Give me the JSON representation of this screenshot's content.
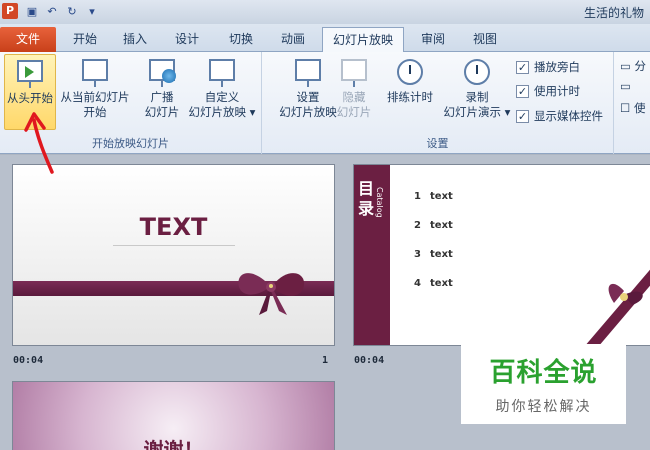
{
  "window": {
    "title": "生活的礼物",
    "app_icon": "P"
  },
  "quick_access": [
    "save-icon",
    "undo-icon",
    "redo-icon",
    "customize-icon"
  ],
  "tabs": [
    {
      "label": "文件",
      "file": true
    },
    {
      "label": "开始"
    },
    {
      "label": "插入"
    },
    {
      "label": "设计"
    },
    {
      "label": "切换"
    },
    {
      "label": "动画"
    },
    {
      "label": "幻灯片放映",
      "active": true
    },
    {
      "label": "审阅"
    },
    {
      "label": "视图"
    }
  ],
  "ribbon": {
    "start_group": {
      "label": "开始放映幻灯片",
      "from_beginning": "从头开始",
      "from_current_l1": "从当前幻灯片",
      "from_current_l2": "开始",
      "broadcast_l1": "广播",
      "broadcast_l2": "幻灯片",
      "custom_l1": "自定义",
      "custom_l2": "幻灯片放映 ▾"
    },
    "setup_group": {
      "label": "设置",
      "setup_l1": "设置",
      "setup_l2": "幻灯片放映",
      "hide_l1": "隐藏",
      "hide_l2": "幻灯片",
      "rehearse": "排练计时",
      "record_l1": "录制",
      "record_l2": "幻灯片演示 ▾",
      "checks": [
        {
          "label": "播放旁白",
          "checked": true
        },
        {
          "label": "使用计时",
          "checked": true
        },
        {
          "label": "显示媒体控件",
          "checked": true
        }
      ]
    },
    "right_partial": [
      "分",
      "",
      "使"
    ]
  },
  "slides": [
    {
      "title": "TEXT",
      "time": "00:04",
      "number": "1"
    },
    {
      "heading": "目录",
      "catalog": "Catalog",
      "items": [
        {
          "num": "1",
          "text": "text"
        },
        {
          "num": "2",
          "text": "text"
        },
        {
          "num": "3",
          "text": "text"
        },
        {
          "num": "4",
          "text": "text"
        }
      ],
      "time": "00:04"
    },
    {
      "title": "谢谢！"
    }
  ],
  "watermark": {
    "title": "百科全说",
    "subtitle": "助你轻松解决"
  },
  "colors": {
    "accent": "#6b1f42",
    "file_tab": "#d24726",
    "watermark": "#2aa12f"
  }
}
